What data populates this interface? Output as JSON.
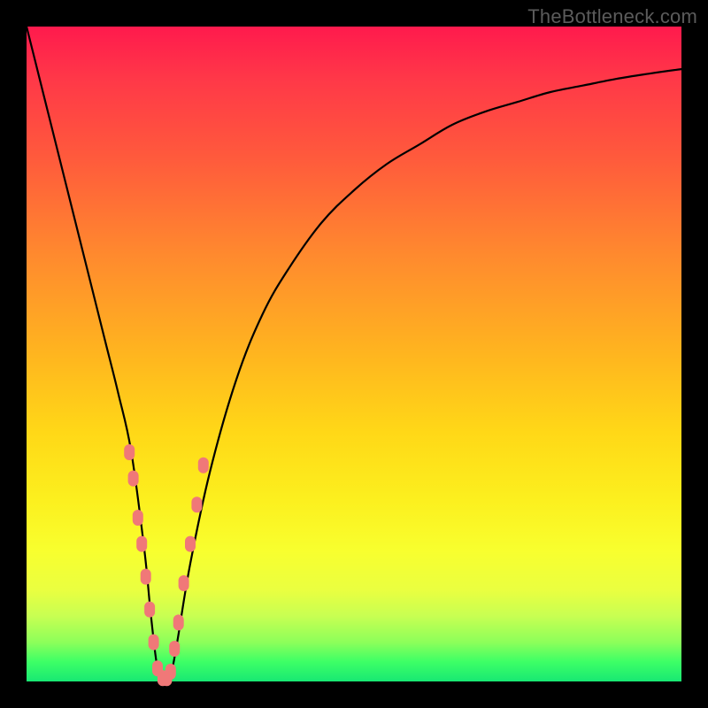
{
  "watermark": "TheBottleneck.com",
  "chart_data": {
    "type": "line",
    "title": "",
    "xlabel": "",
    "ylabel": "",
    "xlim": [
      0,
      100
    ],
    "ylim": [
      0,
      100
    ],
    "series": [
      {
        "name": "bottleneck-curve",
        "x": [
          0,
          2,
          4,
          6,
          8,
          10,
          12,
          14,
          16,
          18,
          19,
          20,
          21,
          22,
          23,
          25,
          28,
          32,
          36,
          40,
          45,
          50,
          55,
          60,
          65,
          70,
          75,
          80,
          85,
          90,
          95,
          100
        ],
        "y": [
          100,
          92,
          84,
          76,
          68,
          60,
          52,
          44,
          35,
          20,
          10,
          2,
          0,
          1,
          6,
          18,
          32,
          46,
          56,
          63,
          70,
          75,
          79,
          82,
          85,
          87,
          88.5,
          90,
          91,
          92,
          92.8,
          93.5
        ]
      }
    ],
    "markers": {
      "color": "#f07878",
      "points": [
        {
          "x": 15.7,
          "y": 35
        },
        {
          "x": 16.3,
          "y": 31
        },
        {
          "x": 17.0,
          "y": 25
        },
        {
          "x": 17.6,
          "y": 21
        },
        {
          "x": 18.2,
          "y": 16
        },
        {
          "x": 18.8,
          "y": 11
        },
        {
          "x": 19.4,
          "y": 6
        },
        {
          "x": 20.0,
          "y": 2
        },
        {
          "x": 20.8,
          "y": 0.5
        },
        {
          "x": 21.4,
          "y": 0.5
        },
        {
          "x": 22.0,
          "y": 1.5
        },
        {
          "x": 22.6,
          "y": 5
        },
        {
          "x": 23.2,
          "y": 9
        },
        {
          "x": 24.0,
          "y": 15
        },
        {
          "x": 25.0,
          "y": 21
        },
        {
          "x": 26.0,
          "y": 27
        },
        {
          "x": 27.0,
          "y": 33
        }
      ]
    }
  }
}
